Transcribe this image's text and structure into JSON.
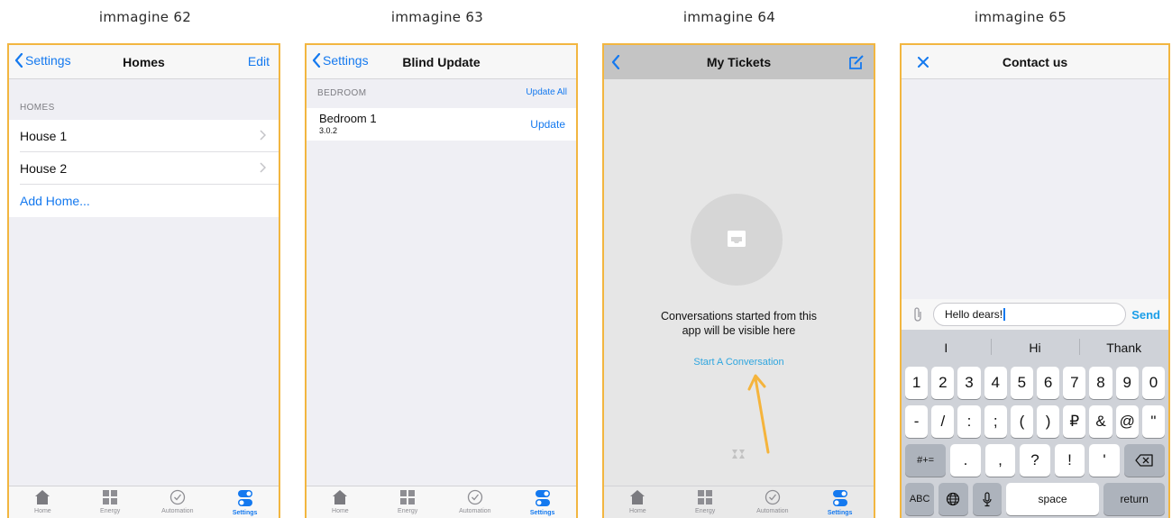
{
  "captions": [
    "immagine 62",
    "immagine 63",
    "immagine 64",
    "immagine 65"
  ],
  "tab_labels": [
    "Home",
    "Energy",
    "Automation",
    "Settings"
  ],
  "screen1": {
    "back_label": "Settings",
    "title": "Homes",
    "edit_label": "Edit",
    "section_header": "HOMES",
    "items": [
      "House 1",
      "House 2"
    ],
    "add_label": "Add Home..."
  },
  "screen2": {
    "back_label": "Settings",
    "title": "Blind Update",
    "section_header": "BEDROOM",
    "update_all_label": "Update All",
    "device_name": "Bedroom 1",
    "device_version": "3.0.2",
    "update_label": "Update"
  },
  "screen3": {
    "title": "My Tickets",
    "empty_line1": "Conversations started from this",
    "empty_line2": "app will be visible here",
    "start_label": "Start A Conversation",
    "accent": "#f5b43c"
  },
  "screen4": {
    "title": "Contact us",
    "input_value": "Hello dears!",
    "send_label": "Send",
    "suggestions": [
      "I",
      "Hi",
      "Thank"
    ],
    "row1": [
      "1",
      "2",
      "3",
      "4",
      "5",
      "6",
      "7",
      "8",
      "9",
      "0"
    ],
    "row2": [
      "-",
      "/",
      ":",
      ";",
      "(",
      ")",
      "₽",
      "&",
      "@",
      "\""
    ],
    "row3_left": "#+=",
    "row3": [
      ".",
      ",",
      "?",
      "!",
      "'"
    ],
    "abc_label": "ABC",
    "space_label": "space",
    "return_label": "return"
  },
  "colors": {
    "accent_blue": "#1479ef",
    "frame_orange": "#f2b640"
  }
}
